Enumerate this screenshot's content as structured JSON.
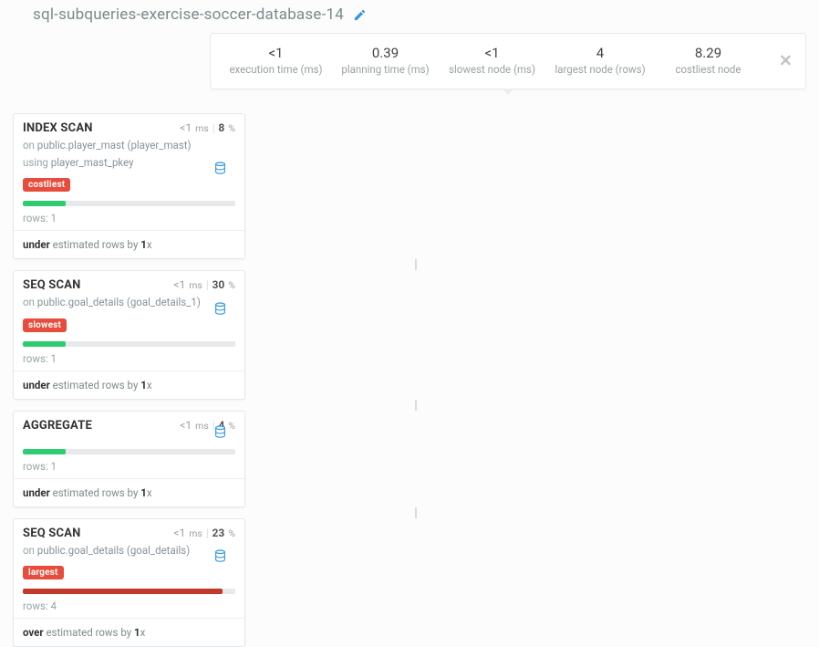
{
  "title": "sql-subqueries-exercise-soccer-database-14",
  "summary": [
    {
      "value": "<1",
      "label": "execution time (ms)"
    },
    {
      "value": "0.39",
      "label": "planning time (ms)"
    },
    {
      "value": "<1",
      "label": "slowest node (ms)"
    },
    {
      "value": "4",
      "label": "largest node (rows)"
    },
    {
      "value": "8.29",
      "label": "costliest node"
    }
  ],
  "nodes": [
    {
      "type": "INDEX SCAN",
      "time": "<1",
      "time_unit": "ms",
      "pct": "8",
      "sub_on_prefix": "on ",
      "sub_on": "public.player_mast (player_mast)",
      "sub_using_prefix": "using ",
      "sub_using": "player_mast_pkey",
      "tag": "costliest",
      "bar_pct": 20,
      "bar_color": "green",
      "rows_label": "rows:",
      "rows": "1",
      "est_dir": "under",
      "est_mid": " estimated rows by ",
      "est_factor": "1",
      "est_suffix": "x",
      "has_db_icon": true
    },
    {
      "type": "SEQ SCAN",
      "time": "<1",
      "time_unit": "ms",
      "pct": "30",
      "sub_on_prefix": "on ",
      "sub_on": "public.goal_details (goal_details_1)",
      "tag": "slowest",
      "bar_pct": 20,
      "bar_color": "green",
      "rows_label": "rows:",
      "rows": "1",
      "est_dir": "under",
      "est_mid": " estimated rows by ",
      "est_factor": "1",
      "est_suffix": "x",
      "has_db_icon": true
    },
    {
      "type": "AGGREGATE",
      "time": "<1",
      "time_unit": "ms",
      "pct": "4",
      "bar_pct": 20,
      "bar_color": "green",
      "rows_label": "rows:",
      "rows": "1",
      "est_dir": "under",
      "est_mid": " estimated rows by ",
      "est_factor": "1",
      "est_suffix": "x",
      "has_db_icon": true
    },
    {
      "type": "SEQ SCAN",
      "time": "<1",
      "time_unit": "ms",
      "pct": "23",
      "sub_on_prefix": "on ",
      "sub_on": "public.goal_details (goal_details)",
      "tag": "largest",
      "bar_pct": 94,
      "bar_color": "red",
      "rows_label": "rows:",
      "rows": "4",
      "est_dir": "over",
      "est_mid": " estimated rows by ",
      "est_factor": "1",
      "est_suffix": "x",
      "has_db_icon": true
    }
  ]
}
